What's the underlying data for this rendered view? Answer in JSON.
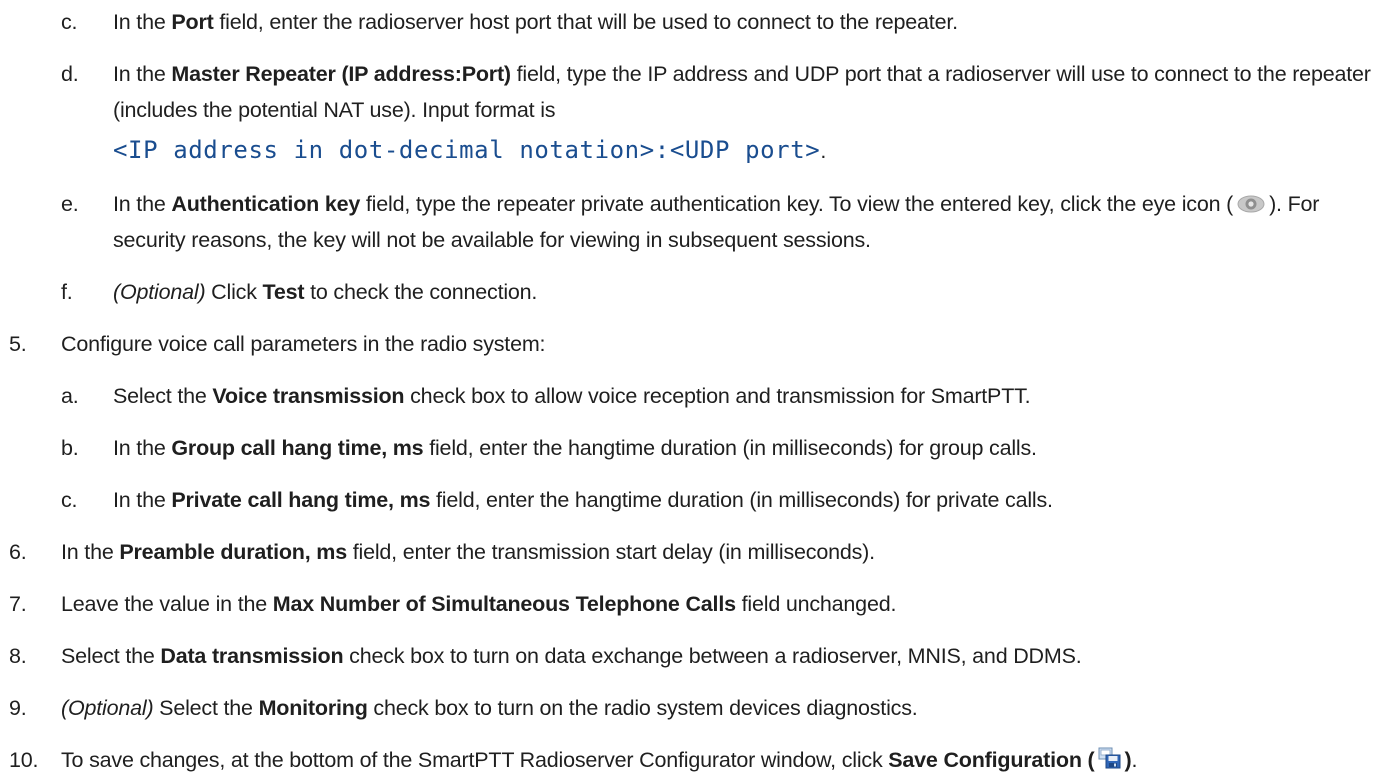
{
  "steps": [
    {
      "num": "c.",
      "parts": [
        {
          "t": "In the "
        },
        {
          "t": "Port",
          "b": true
        },
        {
          "t": " field, enter the radioserver host port that will be used to connect to the repeater."
        }
      ]
    },
    {
      "num": "d.",
      "parts": [
        {
          "t": "In the "
        },
        {
          "t": "Master Repeater (IP address:Port)",
          "b": true
        },
        {
          "t": " field, type the IP address and UDP port that a radioserver will use to connect to the repeater (includes the potential NAT use). Input format is"
        }
      ],
      "code": "<IP address in dot-decimal notation>:<UDP port>",
      "code_suffix": "."
    },
    {
      "num": "e.",
      "parts": [
        {
          "t": "In the "
        },
        {
          "t": "Authentication key",
          "b": true
        },
        {
          "t": " field, type the repeater private authentication key. To view the entered key, click the eye icon ("
        },
        {
          "icon": "eye-icon"
        },
        {
          "t": "). For security reasons, the key will not be available for viewing in subsequent sessions."
        }
      ]
    },
    {
      "num": "f.",
      "parts": [
        {
          "t": "(Optional)",
          "i": true
        },
        {
          "t": " Click "
        },
        {
          "t": "Test",
          "b": true
        },
        {
          "t": " to check the connection."
        }
      ]
    },
    {
      "num": "5.",
      "parts": [
        {
          "t": "Configure voice call parameters in the radio system:"
        }
      ]
    },
    {
      "num": "a.",
      "parts": [
        {
          "t": "Select the "
        },
        {
          "t": "Voice transmission",
          "b": true
        },
        {
          "t": " check box to allow voice reception and transmission for SmartPTT."
        }
      ]
    },
    {
      "num": "b.",
      "parts": [
        {
          "t": "In the "
        },
        {
          "t": "Group call hang time, ms",
          "b": true
        },
        {
          "t": " field, enter the hangtime duration (in milliseconds) for group calls."
        }
      ]
    },
    {
      "num": "c.",
      "parts": [
        {
          "t": "In the "
        },
        {
          "t": "Private call hang time, ms",
          "b": true
        },
        {
          "t": " field, enter the hangtime duration (in milliseconds) for private calls."
        }
      ]
    },
    {
      "num": "6.",
      "parts": [
        {
          "t": "In the "
        },
        {
          "t": "Preamble duration, ms",
          "b": true
        },
        {
          "t": " field, enter the transmission start delay (in milliseconds)."
        }
      ]
    },
    {
      "num": "7.",
      "parts": [
        {
          "t": "Leave the value in the "
        },
        {
          "t": "Max Number of Simultaneous Telephone Calls",
          "b": true
        },
        {
          "t": " field unchanged."
        }
      ]
    },
    {
      "num": "8.",
      "parts": [
        {
          "t": "Select the "
        },
        {
          "t": "Data transmission",
          "b": true
        },
        {
          "t": " check box to turn on data exchange between a radioserver, MNIS, and DDMS."
        }
      ]
    },
    {
      "num": "9.",
      "parts": [
        {
          "t": "(Optional)",
          "i": true
        },
        {
          "t": " Select the "
        },
        {
          "t": "Monitoring",
          "b": true
        },
        {
          "t": " check box to turn on the radio system devices diagnostics."
        }
      ]
    },
    {
      "num": "10.",
      "parts": [
        {
          "t": "To save changes, at the bottom of the SmartPTT Radioserver Configurator window, click "
        },
        {
          "t": "Save Configuration (",
          "b": true
        },
        {
          "icon": "save-icon"
        },
        {
          "t": ")",
          "b": true
        },
        {
          "t": "."
        }
      ]
    }
  ],
  "colors": {
    "text": "#1f1f1f",
    "code": "#1a4d8f"
  }
}
